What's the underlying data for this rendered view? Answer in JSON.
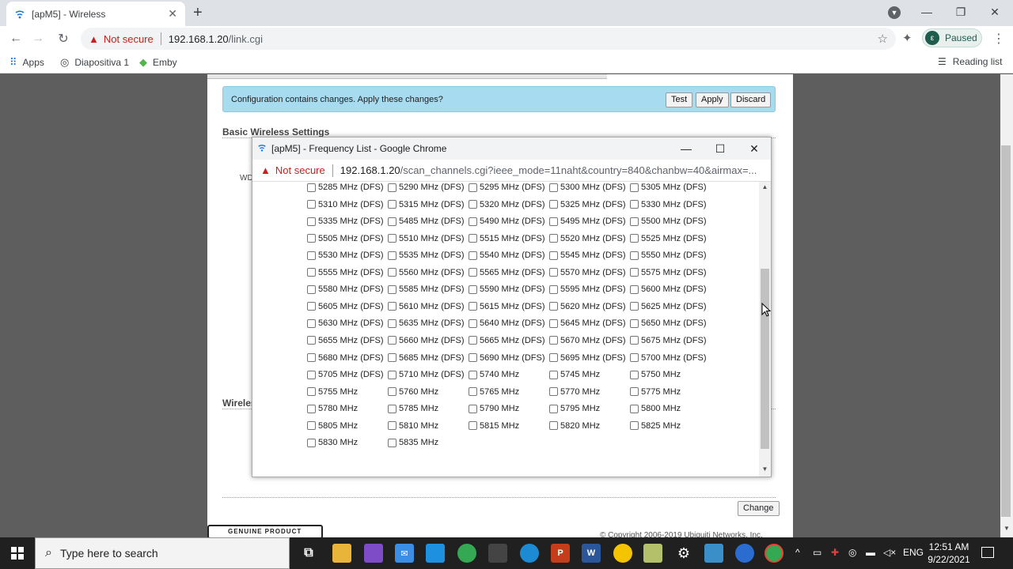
{
  "browser": {
    "tab_title": "[apM5] - Wireless",
    "url_warning": "Not secure",
    "url_host": "192.168.1.20",
    "url_path": "/link.cgi",
    "profile_initial": "ε",
    "profile_status": "Paused",
    "bookmarks": [
      "Apps",
      "Diapositiva 1",
      "Emby"
    ],
    "reading_list": "Reading list"
  },
  "page": {
    "notice_text": "Configuration contains changes. Apply these changes?",
    "test_label": "Test",
    "apply_label": "Apply",
    "discard_label": "Discard",
    "basic_section": "Basic Wireless Settings",
    "wds_fragment": "WD",
    "wireless_fragment": "Wireles",
    "change_label": "Change",
    "genuine_text": "GENUINE PRODUCT",
    "copyright": "© Copyright 2006-2019 Ubiquiti Networks, Inc."
  },
  "popup": {
    "title": "[apM5] - Frequency List - Google Chrome",
    "url_warning": "Not secure",
    "url_host": "192.168.1.20",
    "url_path": "/scan_channels.cgi?ieee_mode=11naht&country=840&chanbw=40&airmax=...",
    "rows": [
      [
        "5285 MHz (DFS)",
        "5290 MHz (DFS)",
        "5295 MHz (DFS)",
        "5300 MHz (DFS)",
        "5305 MHz (DFS)"
      ],
      [
        "5310 MHz (DFS)",
        "5315 MHz (DFS)",
        "5320 MHz (DFS)",
        "5325 MHz (DFS)",
        "5330 MHz (DFS)"
      ],
      [
        "5335 MHz (DFS)",
        "5485 MHz (DFS)",
        "5490 MHz (DFS)",
        "5495 MHz (DFS)",
        "5500 MHz (DFS)"
      ],
      [
        "5505 MHz (DFS)",
        "5510 MHz (DFS)",
        "5515 MHz (DFS)",
        "5520 MHz (DFS)",
        "5525 MHz (DFS)"
      ],
      [
        "5530 MHz (DFS)",
        "5535 MHz (DFS)",
        "5540 MHz (DFS)",
        "5545 MHz (DFS)",
        "5550 MHz (DFS)"
      ],
      [
        "5555 MHz (DFS)",
        "5560 MHz (DFS)",
        "5565 MHz (DFS)",
        "5570 MHz (DFS)",
        "5575 MHz (DFS)"
      ],
      [
        "5580 MHz (DFS)",
        "5585 MHz (DFS)",
        "5590 MHz (DFS)",
        "5595 MHz (DFS)",
        "5600 MHz (DFS)"
      ],
      [
        "5605 MHz (DFS)",
        "5610 MHz (DFS)",
        "5615 MHz (DFS)",
        "5620 MHz (DFS)",
        "5625 MHz (DFS)"
      ],
      [
        "5630 MHz (DFS)",
        "5635 MHz (DFS)",
        "5640 MHz (DFS)",
        "5645 MHz (DFS)",
        "5650 MHz (DFS)"
      ],
      [
        "5655 MHz (DFS)",
        "5660 MHz (DFS)",
        "5665 MHz (DFS)",
        "5670 MHz (DFS)",
        "5675 MHz (DFS)"
      ],
      [
        "5680 MHz (DFS)",
        "5685 MHz (DFS)",
        "5690 MHz (DFS)",
        "5695 MHz (DFS)",
        "5700 MHz (DFS)"
      ],
      [
        "5705 MHz (DFS)",
        "5710 MHz (DFS)",
        "5740 MHz",
        "5745 MHz",
        "5750 MHz"
      ],
      [
        "5755 MHz",
        "5760 MHz",
        "5765 MHz",
        "5770 MHz",
        "5775 MHz"
      ],
      [
        "5780 MHz",
        "5785 MHz",
        "5790 MHz",
        "5795 MHz",
        "5800 MHz"
      ],
      [
        "5805 MHz",
        "5810 MHz",
        "5815 MHz",
        "5820 MHz",
        "5825 MHz"
      ],
      [
        "5830 MHz",
        "5835 MHz"
      ]
    ]
  },
  "taskbar": {
    "search_placeholder": "Type here to search",
    "language": "ENG",
    "time": "12:51 AM",
    "date": "9/22/2021"
  }
}
